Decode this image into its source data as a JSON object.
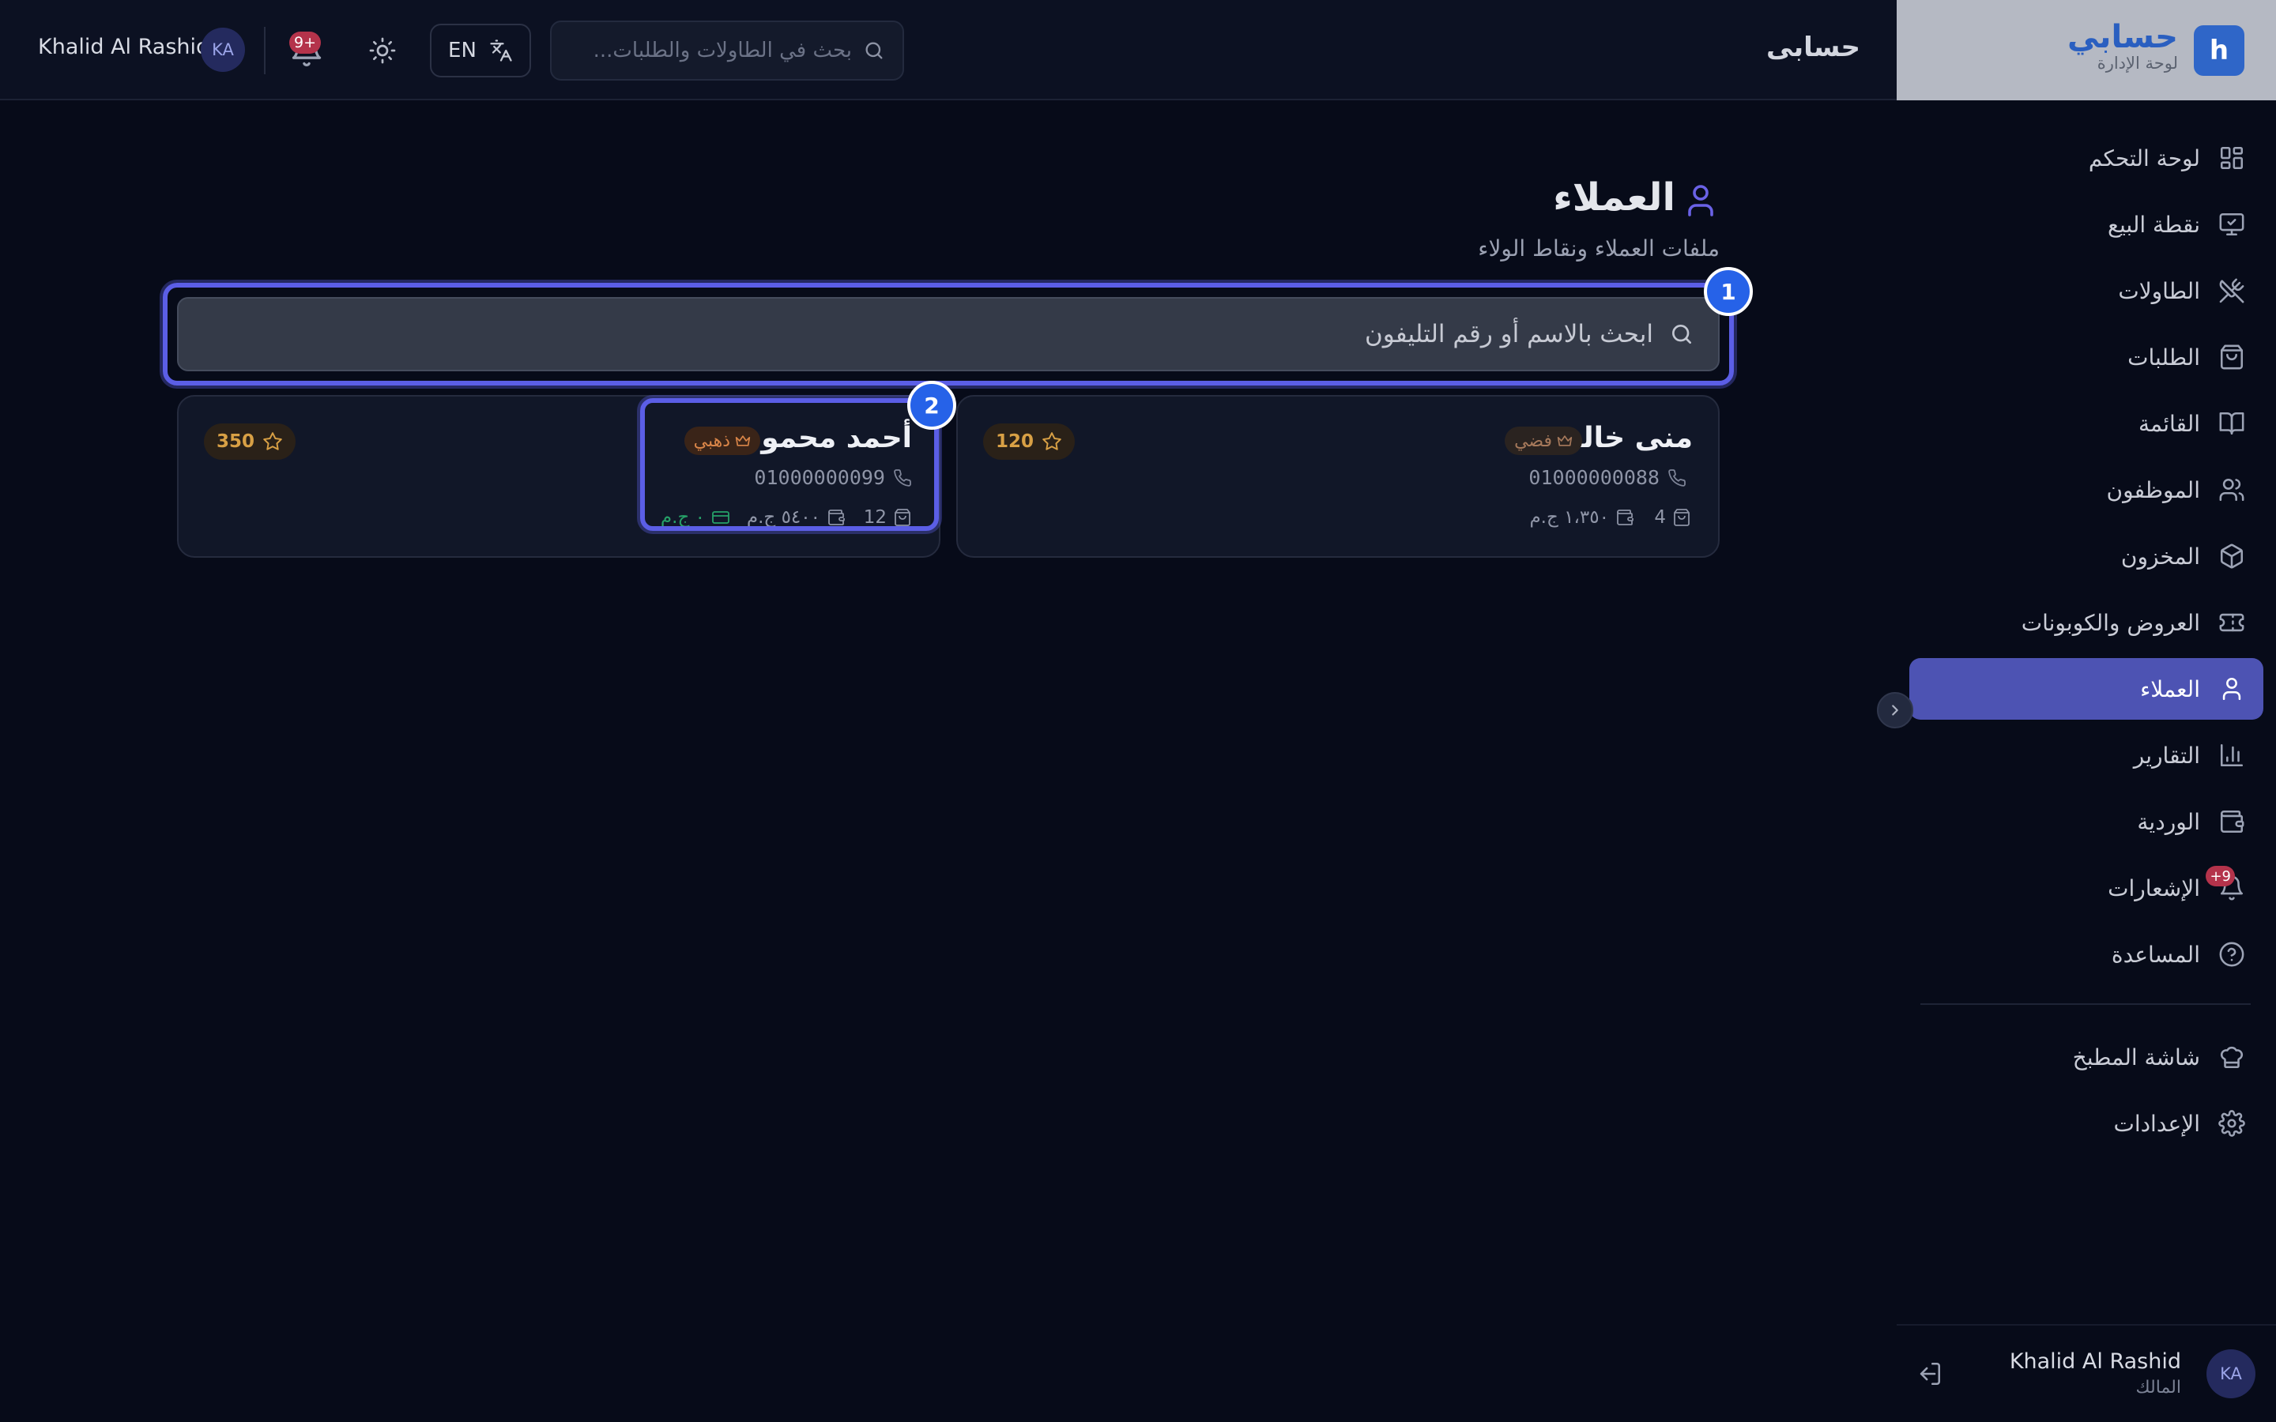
{
  "topbar": {
    "user_name": "Khalid Al Rashid",
    "user_initials": "KA",
    "notifications_badge": "9+",
    "language_label": "EN",
    "search_placeholder": "بحث في الطاولات والطلبات...",
    "app_title": "حسابى"
  },
  "brand": {
    "logo_letter": "h",
    "name": "حسابي",
    "subtitle": "لوحة الإدارة"
  },
  "sidebar": {
    "items": [
      {
        "label": "لوحة التحكم",
        "icon": "dashboard-icon"
      },
      {
        "label": "نقطة البيع",
        "icon": "monitor-icon"
      },
      {
        "label": "الطاولات",
        "icon": "utensils-icon"
      },
      {
        "label": "الطلبات",
        "icon": "shopping-bag-icon"
      },
      {
        "label": "القائمة",
        "icon": "book-icon"
      },
      {
        "label": "الموظفون",
        "icon": "users-icon"
      },
      {
        "label": "المخزون",
        "icon": "package-icon"
      },
      {
        "label": "العروض والكوبونات",
        "icon": "ticket-icon"
      },
      {
        "label": "العملاء",
        "icon": "user-icon",
        "active": true
      },
      {
        "label": "التقارير",
        "icon": "bar-chart-icon"
      },
      {
        "label": "الوردية",
        "icon": "wallet-icon"
      },
      {
        "label": "الإشعارات",
        "icon": "bell-icon",
        "badge": "9+"
      },
      {
        "label": "المساعدة",
        "icon": "help-circle-icon"
      },
      {
        "label": "شاشة المطبخ",
        "icon": "chef-hat-icon"
      },
      {
        "label": "الإعدادات",
        "icon": "settings-icon"
      }
    ],
    "user_name": "Khalid Al Rashid",
    "user_role": "المالك",
    "user_initials": "KA"
  },
  "page": {
    "title": "العملاء",
    "subtitle": "ملفات العملاء ونقاط الولاء",
    "search_placeholder": "ابحث بالاسم أو رقم التليفون"
  },
  "annotations": [
    "1",
    "2"
  ],
  "customers": [
    {
      "name": "منى خالد",
      "tier": "فضي",
      "phone": "01000000088",
      "orders": "4",
      "spent": "١،٣٥٠ ج.م",
      "points": "120"
    },
    {
      "name": "أحمد محمود",
      "tier": "ذهبي",
      "phone": "01000000099",
      "orders": "12",
      "spent": "٥٤٠٠ ج.م",
      "balance": "٠ ج.م",
      "points": "350"
    }
  ],
  "colors": {
    "background": "#070b19",
    "accent": "#4d53b3",
    "brand_blue": "#2f66c8",
    "annotation_blue": "#2662e8",
    "points_gold": "#d8a045"
  }
}
